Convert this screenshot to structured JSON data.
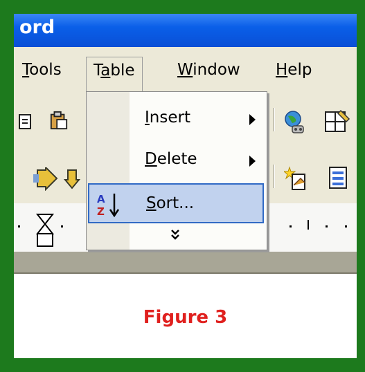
{
  "window": {
    "title": "ord"
  },
  "menubar": {
    "items": [
      {
        "label": "Tools",
        "key": "T"
      },
      {
        "label": "Table",
        "key": "a",
        "active": true
      },
      {
        "label": "Window",
        "key": "W"
      },
      {
        "label": "Help",
        "key": "H"
      }
    ]
  },
  "dropdown": {
    "items": [
      {
        "label": "Insert",
        "submenu": true
      },
      {
        "label": "Delete",
        "submenu": true
      },
      {
        "label": "Sort...",
        "submenu": false,
        "highlighted": true,
        "icon": "sort-ascending-icon"
      }
    ],
    "expand_glyph": "»"
  },
  "document": {
    "caption": "Figure 3"
  },
  "colors": {
    "frame": "#1d7a1d",
    "titlebar": "#0a5fe8",
    "menu_bg": "#ece9d8",
    "highlight": "#c1d2ee",
    "highlight_border": "#316ac5",
    "caption": "#e0201e"
  }
}
